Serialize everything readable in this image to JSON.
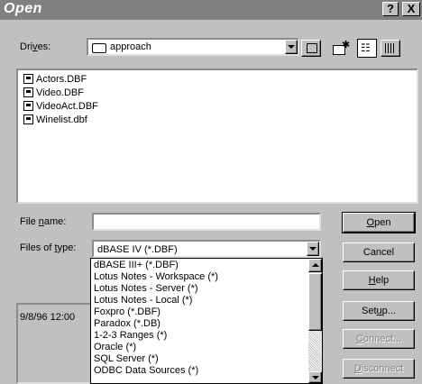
{
  "window": {
    "title": "Open",
    "help_btn": "?",
    "close_btn": "X"
  },
  "drives": {
    "label_pre": "Dri",
    "label_ul": "v",
    "label_post": "es:",
    "value": "approach"
  },
  "files": [
    "Actors.DBF",
    "Video.DBF",
    "VideoAct.DBF",
    "Winelist.dbf"
  ],
  "filename": {
    "label_pre": "File ",
    "label_ul": "n",
    "label_post": "ame:",
    "value": ""
  },
  "filetype": {
    "label_pre": "Files of ",
    "label_ul": "t",
    "label_post": "ype:",
    "value": "dBASE IV (*.DBF)",
    "options": [
      "dBASE III+ (*.DBF)",
      "Lotus Notes - Workspace (*)",
      "Lotus Notes - Server (*)",
      "Lotus Notes - Local (*)",
      "Foxpro (*.DBF)",
      "Paradox (*.DB)",
      "1-2-3 Ranges (*)",
      "Oracle (*)",
      "SQL Server (*)",
      "ODBC Data Sources (*)"
    ]
  },
  "info_text": "9/8/96  12:00",
  "buttons": {
    "open": {
      "ul": "O",
      "rest": "pen"
    },
    "cancel": "Cancel",
    "help": {
      "ul": "H",
      "rest": "elp"
    },
    "setup": {
      "pre": "Set",
      "ul": "u",
      "rest": "p..."
    },
    "connect": {
      "ul": "C",
      "rest": "onnect..."
    },
    "disconnect": {
      "ul": "D",
      "rest": "isconnect"
    }
  }
}
